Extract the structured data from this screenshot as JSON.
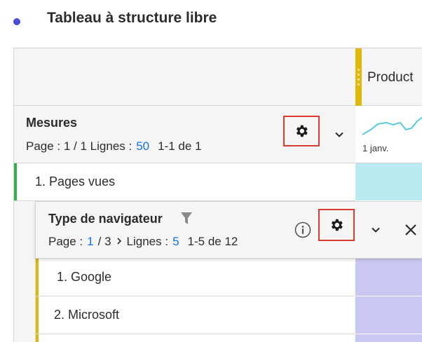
{
  "page": {
    "title": "Tableau à structure libre"
  },
  "table": {
    "column_header": "Product",
    "metrics": {
      "title": "Mesures",
      "pager_prefix": "Page : 1 / 1 Lignes :",
      "rows_per_page": "50",
      "range": "1-1 de 1",
      "chart_start_label": "1 janv."
    },
    "metric_rows": [
      {
        "label": "1. Pages vues"
      }
    ],
    "breakdown": {
      "title": "Type de navigateur",
      "page_label": "Page :",
      "current_page": "1",
      "total_pages": "/ 3",
      "rows_label": "Lignes :",
      "rows_per_page": "5",
      "range": "1-5 de 12",
      "rows": [
        {
          "label": "1. Google"
        },
        {
          "label": "2. Microsoft"
        }
      ]
    }
  },
  "colors": {
    "accent_bullet": "#4b4bd8",
    "metric_green": "#2fb04b",
    "dimension_yellow": "#e0b806",
    "highlight_red": "#d93b31",
    "link_blue": "#1473e6",
    "teal_cell": "#b9eaf0",
    "lavender_cell": "#c9c8f2"
  }
}
